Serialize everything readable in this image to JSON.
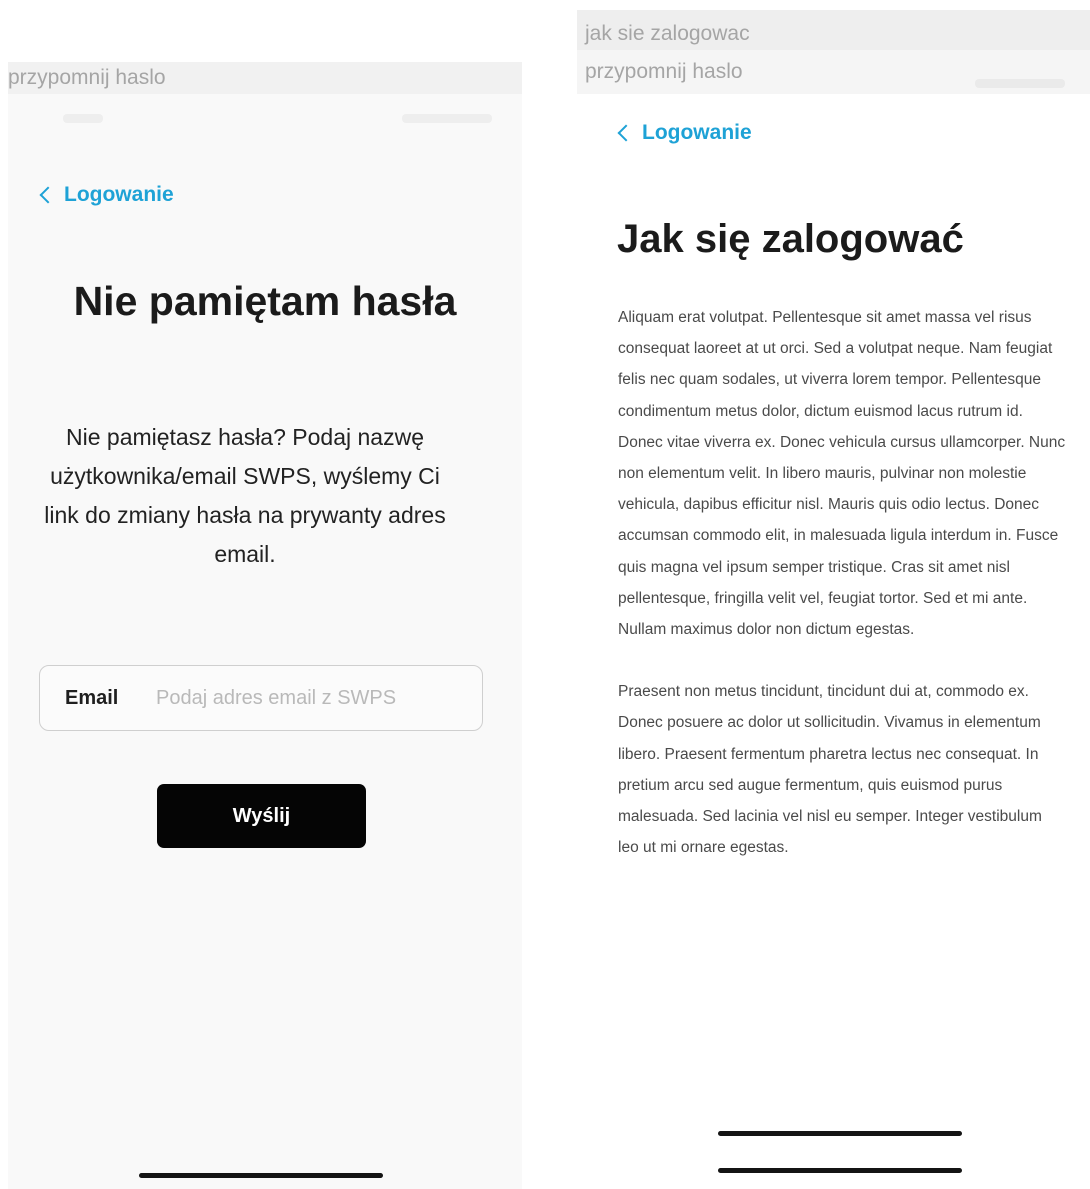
{
  "left": {
    "caption": "przypomnij haslo",
    "back_label": "Logowanie",
    "title": "Nie pamiętam hasła",
    "description": "Nie pamiętasz hasła? Podaj nazwę użytkownika/email SWPS, wyślemy Ci link do zmiany hasła na prywanty adres email.",
    "email_label": "Email",
    "email_placeholder": "Podaj adres email z SWPS",
    "email_value": "",
    "submit_label": "Wyślij"
  },
  "right": {
    "caption_1": "jak sie zalogowac",
    "caption_2": "przypomnij haslo",
    "back_label": "Logowanie",
    "title": "Jak się zalogować",
    "paragraphs": [
      "Aliquam erat volutpat. Pellentesque sit amet massa vel risus consequat laoreet at ut orci. Sed a volutpat neque. Nam feugiat felis nec quam sodales, ut viverra lorem tempor. Pellentesque condimentum metus dolor, dictum euismod lacus rutrum id. Donec vitae viverra ex. Donec vehicula cursus ullamcorper. Nunc non elementum velit. In libero mauris, pulvinar non molestie vehicula, dapibus efficitur nisl. Mauris quis odio lectus. Donec accumsan commodo elit, in malesuada ligula interdum in. Fusce quis magna vel ipsum semper tristique. Cras sit amet nisl pellentesque, fringilla velit vel, feugiat tortor. Sed et mi ante. Nullam maximus dolor non dictum egestas.",
      "Praesent non metus tincidunt, tincidunt dui at, commodo ex. Donec posuere ac dolor ut sollicitudin. Vivamus in elementum libero. Praesent fermentum pharetra lectus nec consequat. In pretium arcu sed augue fermentum, quis euismod purus malesuada. Sed lacinia vel nisl eu semper. Integer vestibulum leo ut mi ornare egestas."
    ]
  },
  "colors": {
    "accent": "#1ea2d6",
    "button_bg": "#050505",
    "button_text": "#ffffff",
    "caption_text": "#a5a5a5"
  },
  "icons": {
    "back": "chevron-left-icon"
  }
}
